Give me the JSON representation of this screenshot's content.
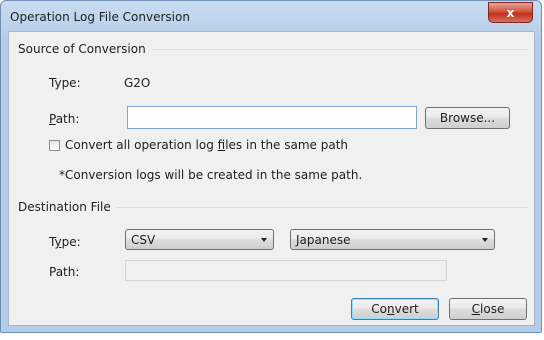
{
  "window": {
    "title": "Operation Log File Conversion",
    "close_glyph": "x"
  },
  "source": {
    "group_title": "Source of Conversion",
    "type_label": "Type:",
    "type_value": "G2O",
    "path_label_prefix": "",
    "path_label_mnemonic": "P",
    "path_label_rest": "ath:",
    "path_value": "",
    "browse_label": "Browse...",
    "convert_all_prefix": "Convert all operation log ",
    "convert_all_mnemonic": "f",
    "convert_all_rest": "iles in the same path",
    "convert_all_checked": false,
    "note": "*Conversion logs will be created in the same path."
  },
  "destination": {
    "group_title": "Destination File",
    "type_label_prefix": "T",
    "type_label_mnemonic": "y",
    "type_label_rest": "pe:",
    "type_value": "CSV",
    "language_value": "Japanese",
    "path_label": "Path:",
    "path_value": ""
  },
  "buttons": {
    "convert_prefix": "Co",
    "convert_mnemonic": "n",
    "convert_rest": "vert",
    "close_prefix": "",
    "close_mnemonic": "C",
    "close_rest": "lose"
  }
}
